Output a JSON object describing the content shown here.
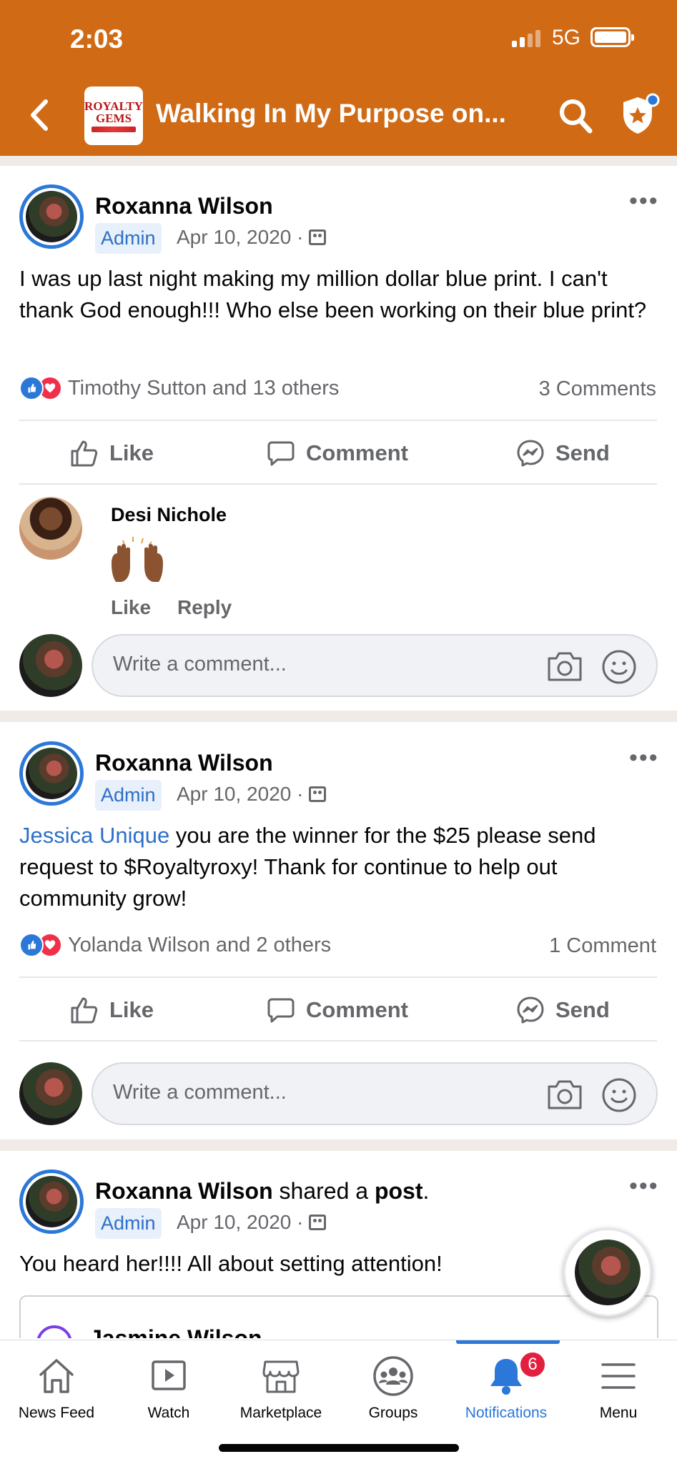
{
  "status_bar": {
    "time": "2:03",
    "network": "5G"
  },
  "header": {
    "logo_line1": "ROYALTY",
    "logo_line2": "GEMS",
    "title": "Walking In My Purpose on..."
  },
  "colors": {
    "brand": "#d06a15",
    "accent": "#2b78d8",
    "badge": "#e41e3f"
  },
  "posts": [
    {
      "author": "Roxanna Wilson",
      "role": "Admin",
      "date": "Apr 10, 2020 ·",
      "text": "I was up last night making my million dollar blue print. I can't thank God enough!!! Who else been working on their blue print?",
      "reactions": "Timothy Sutton and 13 others",
      "comments_count": "3 Comments",
      "actions": {
        "like": "Like",
        "comment": "Comment",
        "send": "Send"
      },
      "comment": {
        "author": "Desi Nichole",
        "emoji": "raised-hands",
        "like": "Like",
        "reply": "Reply"
      },
      "composer_placeholder": "Write a comment..."
    },
    {
      "author": "Roxanna Wilson",
      "role": "Admin",
      "date": "Apr 10, 2020 ·",
      "mention": "Jessica Unique",
      "text": " you are the winner for the $25 please send request to $Royaltyroxy! Thank for continue to help out community grow!",
      "reactions": "Yolanda Wilson and 2 others",
      "comments_count": "1 Comment",
      "actions": {
        "like": "Like",
        "comment": "Comment",
        "send": "Send"
      },
      "composer_placeholder": "Write a comment..."
    },
    {
      "author": "Roxanna Wilson",
      "shared_text": " shared a ",
      "shared_obj": "post",
      "shared_end": ".",
      "role": "Admin",
      "date": "Apr 10, 2020 ·",
      "text": "You heard her!!!! All about setting attention!",
      "shared_author": "Jasmine Wilson"
    }
  ],
  "bottom_nav": [
    {
      "label": "News Feed",
      "icon": "home-icon"
    },
    {
      "label": "Watch",
      "icon": "watch-icon"
    },
    {
      "label": "Marketplace",
      "icon": "marketplace-icon"
    },
    {
      "label": "Groups",
      "icon": "groups-icon"
    },
    {
      "label": "Notifications",
      "icon": "bell-icon",
      "badge": "6",
      "active": true
    },
    {
      "label": "Menu",
      "icon": "menu-icon"
    }
  ]
}
